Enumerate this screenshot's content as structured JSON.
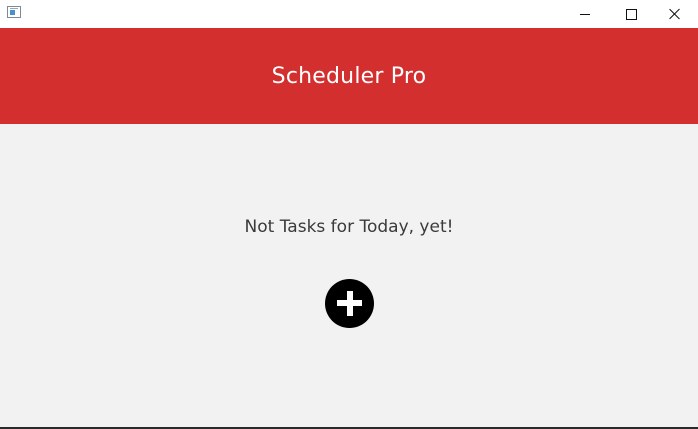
{
  "window": {
    "icon": "app-window-icon",
    "controls": {
      "minimize_icon": "minimize-icon",
      "maximize_icon": "maximize-icon",
      "close_icon": "close-icon"
    }
  },
  "header": {
    "title": "Scheduler Pro",
    "background_color": "#d32f2f"
  },
  "main": {
    "empty_message": "Not Tasks for Today, yet!",
    "add_button_icon": "plus-icon"
  }
}
